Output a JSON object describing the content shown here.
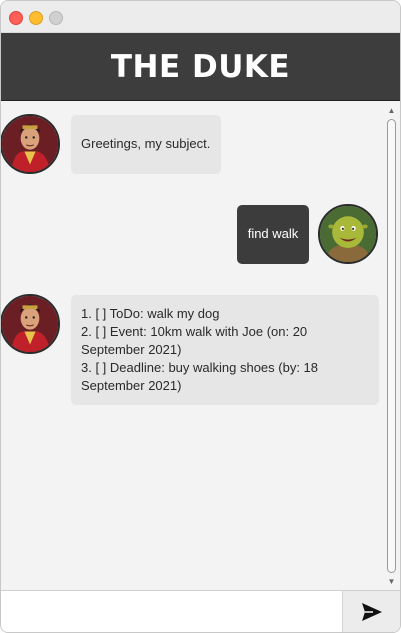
{
  "header": {
    "title": "THE DUKE"
  },
  "messages": [
    {
      "sender": "duke",
      "text": "Greetings, my subject."
    },
    {
      "sender": "user",
      "text": "find walk"
    },
    {
      "sender": "duke",
      "lines": [
        "1. [ ] ToDo: walk my dog",
        "2. [ ] Event: 10km walk with Joe (on: 20",
        "September 2021)",
        "3. [ ] Deadline: buy walking shoes (by: 18",
        "September 2021)"
      ]
    }
  ],
  "input": {
    "value": "",
    "placeholder": ""
  },
  "icons": {
    "send": "send-icon",
    "duke_avatar": "duke-avatar",
    "user_avatar": "shrek-avatar"
  },
  "colors": {
    "header_bg": "#3d3d3d",
    "user_bubble": "#3c3c3c",
    "duke_bubble": "#e6e6e6",
    "chat_bg": "#f3f3f3"
  }
}
